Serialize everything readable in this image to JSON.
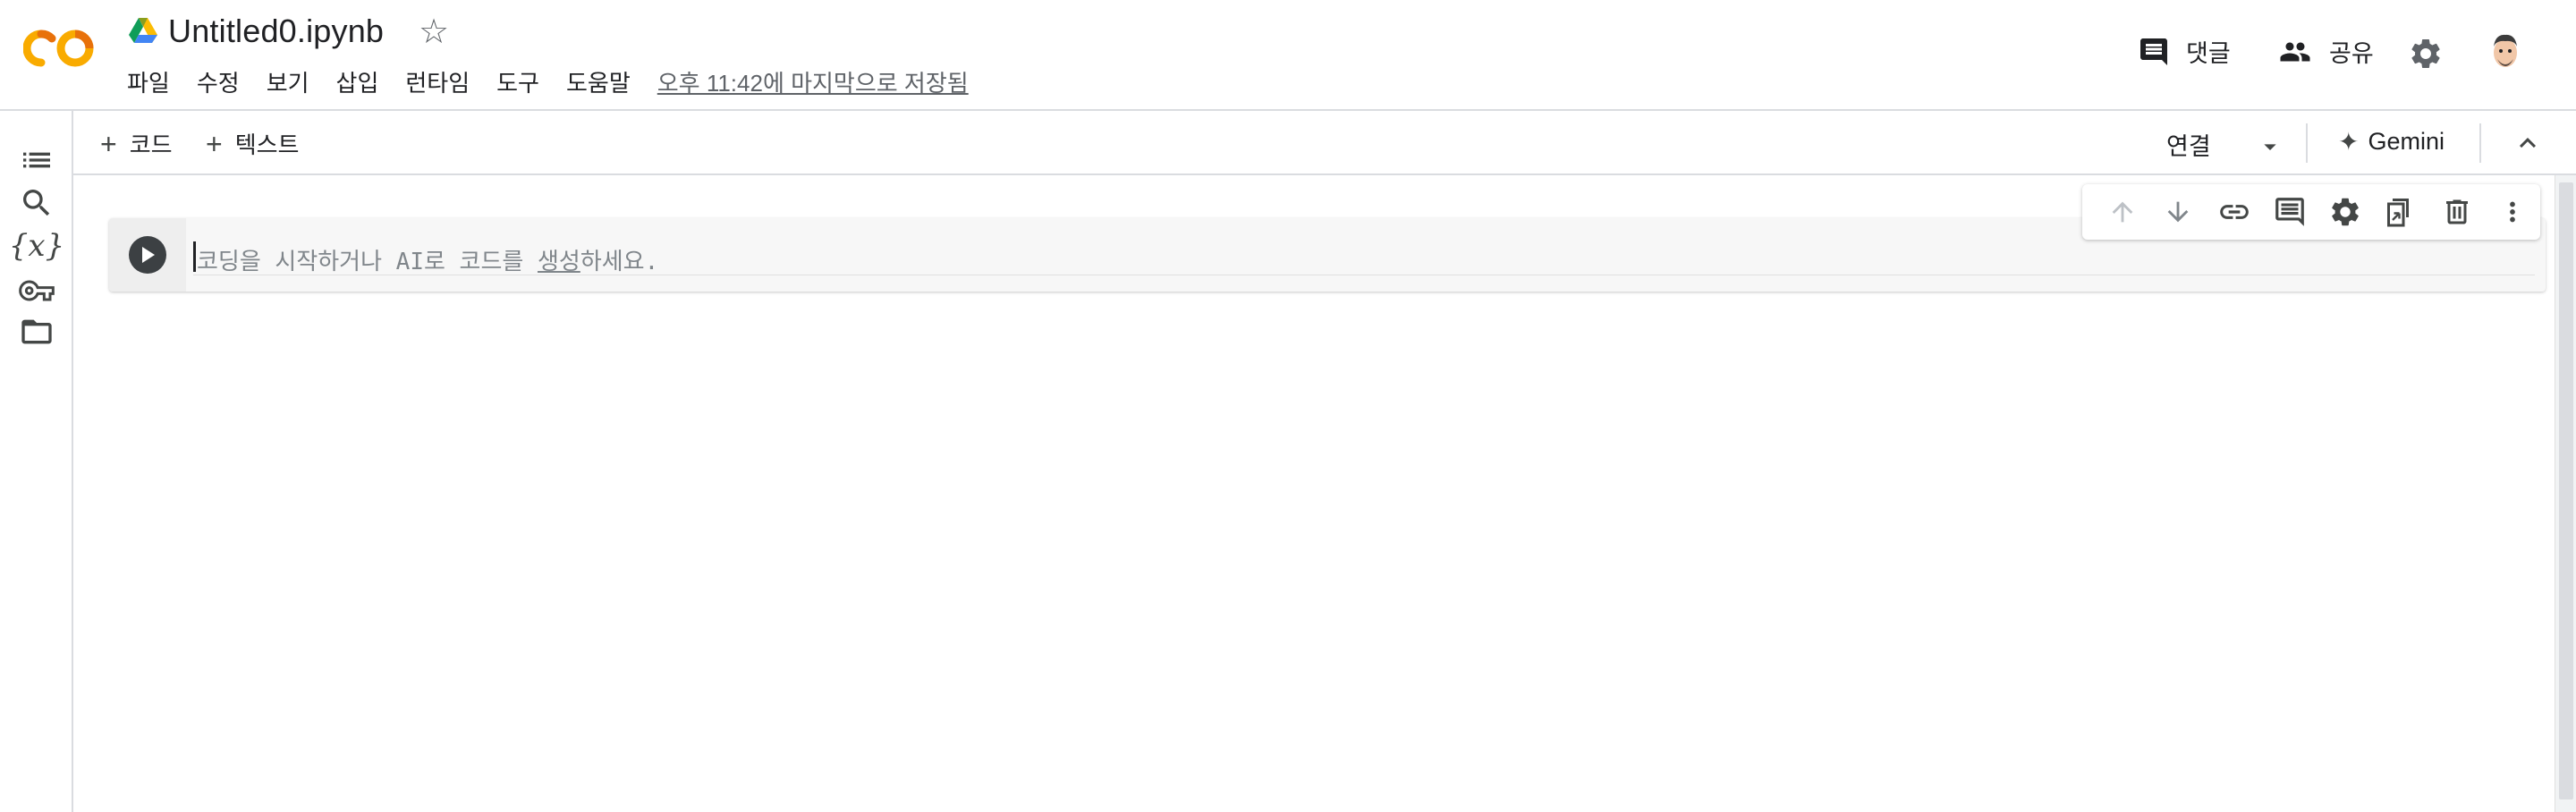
{
  "header": {
    "notebook_title": "Untitled0.ipynb",
    "menu": [
      "파일",
      "수정",
      "보기",
      "삽입",
      "런타임",
      "도구",
      "도움말"
    ],
    "saved_status": "오후 11:42에 마지막으로 저장됨",
    "comment_label": "댓글",
    "share_label": "공유"
  },
  "toolbar": {
    "add_code_label": "코드",
    "add_text_label": "텍스트",
    "connect_label": "연결",
    "gemini_label": "Gemini"
  },
  "siderail": {
    "variables_label": "{x}"
  },
  "cell": {
    "placeholder_before": "코딩을 시작하거나 AI로 코드를 ",
    "placeholder_link": "생성",
    "placeholder_after": "하세요."
  },
  "colors": {
    "logo_orange": "#f9ab00",
    "logo_dark_orange": "#e8710a",
    "border": "#dadce0",
    "icon_gray": "#5f6368"
  }
}
